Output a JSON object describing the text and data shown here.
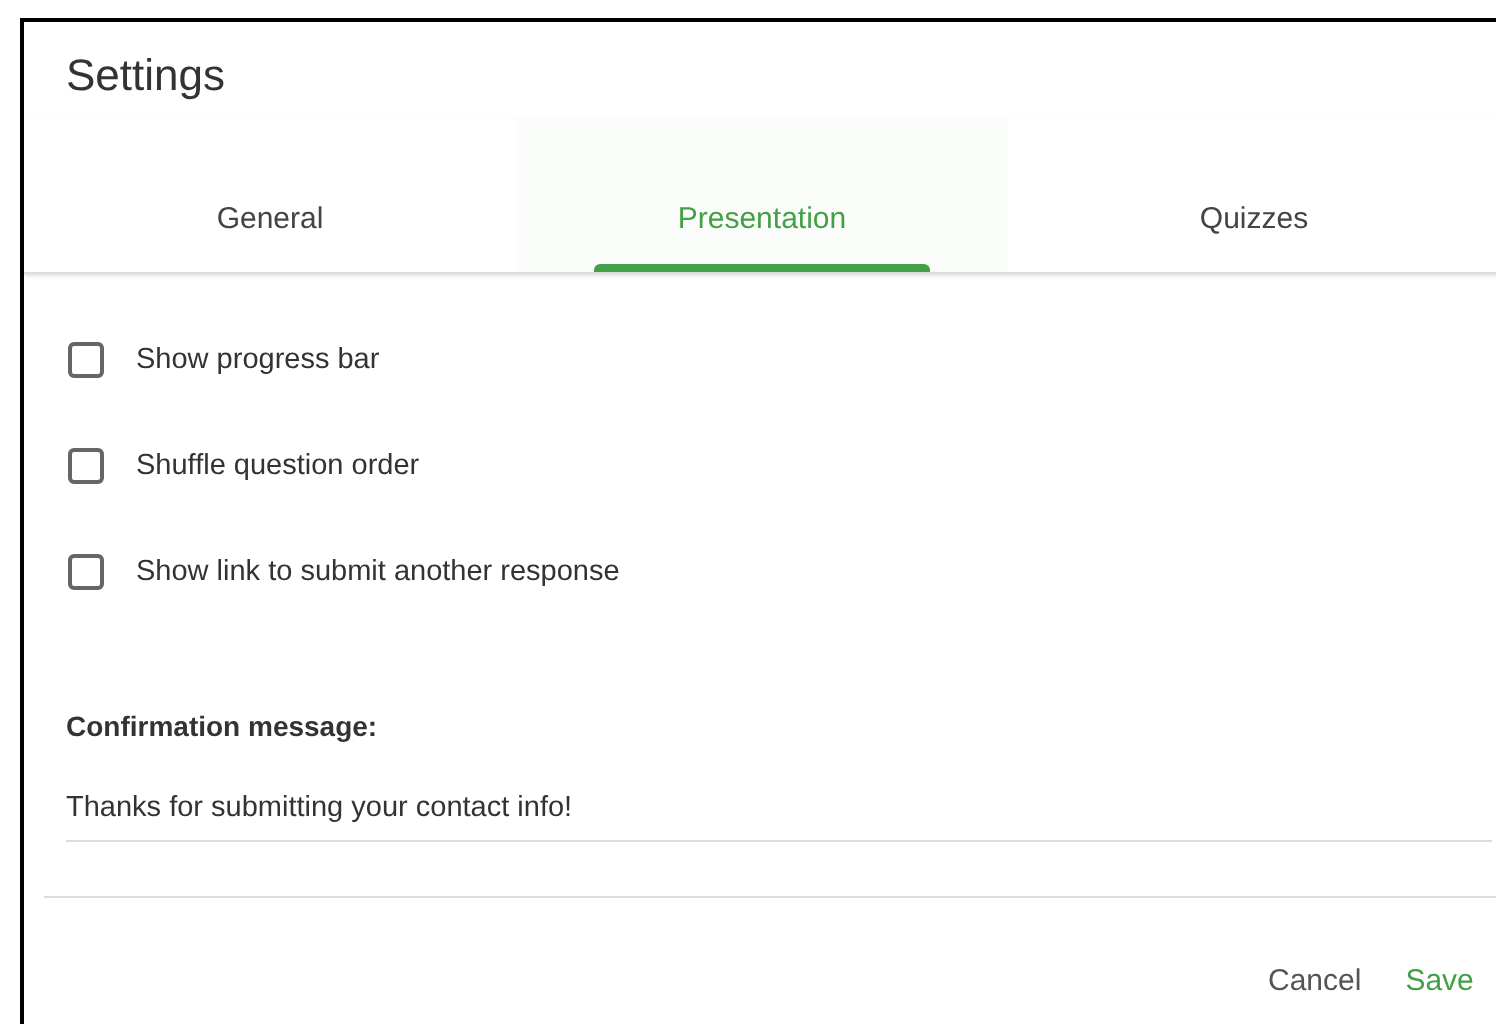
{
  "dialog": {
    "title": "Settings"
  },
  "tabs": [
    {
      "label": "General",
      "selected": false
    },
    {
      "label": "Presentation",
      "selected": true
    },
    {
      "label": "Quizzes",
      "selected": false
    }
  ],
  "options": [
    {
      "label": "Show progress bar",
      "checked": false
    },
    {
      "label": "Shuffle question order",
      "checked": false
    },
    {
      "label": "Show link to submit another response",
      "checked": false
    }
  ],
  "confirmation": {
    "label": "Confirmation message:",
    "value": "Thanks for submitting your contact info!"
  },
  "buttons": [
    {
      "label": "Cancel",
      "kind": "secondary"
    },
    {
      "label": "Save",
      "kind": "primary"
    }
  ]
}
